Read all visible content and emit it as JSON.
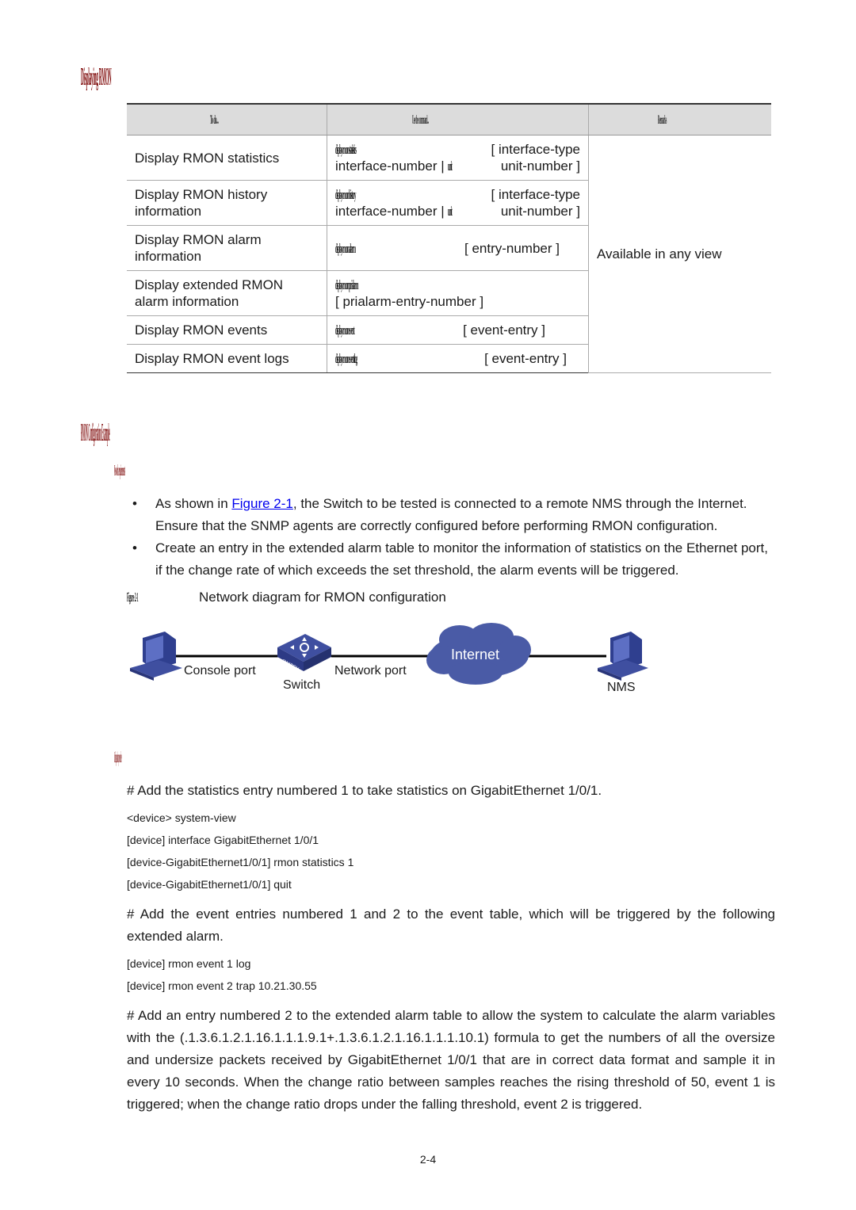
{
  "headings": {
    "displaying": "Displaying RMON",
    "config_example": "RMON Configuration Example",
    "network_requirements": "Network requirements",
    "configuration_procedure": "Configuration procedure"
  },
  "table": {
    "headers": [
      "To do...",
      "Use the command...",
      "Remarks"
    ],
    "rows": [
      {
        "todo": "Display RMON statistics",
        "kw": "display rmon statistics",
        "args_line1": "[ interface-type",
        "args_line2_pre": "interface-number | ",
        "kw2": "unit",
        "args_line2_post": "unit-number ]"
      },
      {
        "todo": "Display RMON history information",
        "kw": "display rmon history",
        "args_line1": "[ interface-type",
        "args_line2_pre": "interface-number | ",
        "kw2": "unit",
        "args_line2_post": "unit-number ]"
      },
      {
        "todo": "Display RMON alarm information",
        "kw": "display rmon alarm",
        "args_line1": "[ entry-number ]"
      },
      {
        "todo": "Display extended RMON alarm information",
        "kw": "display rmon prialarm",
        "args_line2": "[ prialarm-entry-number ]"
      },
      {
        "todo": "Display RMON events",
        "kw": "display rmon event",
        "args_line1": "[ event-entry ]"
      },
      {
        "todo": "Display RMON event logs",
        "kw": "display rmon eventlog",
        "args_line1": "[ event-entry ]"
      }
    ],
    "remarks": "Available in any view"
  },
  "requirements": {
    "bullets": [
      {
        "pre": "As shown in ",
        "link": "Figure 2-1",
        "post": ", the Switch to be tested is connected to a remote NMS through the Internet. Ensure that the SNMP agents are correctly configured before performing RMON configuration."
      },
      {
        "text": "Create an entry in the extended alarm table to monitor the information of statistics on the Ethernet port, if the change rate of which exceeds the set threshold, the alarm events will be triggered."
      }
    ]
  },
  "figure": {
    "number": "Figure 2-1",
    "caption": "Network diagram for RMON configuration",
    "labels": {
      "console_port": "Console port",
      "switch": "Switch",
      "switch_badge": "SWITCH",
      "network_port": "Network port",
      "internet": "Internet",
      "nms": "NMS"
    },
    "colors": {
      "device": "#3f4fa0",
      "cloud": "#4a5ba6"
    }
  },
  "procedure": {
    "step1": "# Add the statistics entry numbered 1 to take statistics on GigabitEthernet 1/0/1.",
    "code1": [
      "<device> system-view",
      "[device] interface GigabitEthernet 1/0/1",
      "[device-GigabitEthernet1/0/1] rmon statistics 1",
      "[device-GigabitEthernet1/0/1] quit"
    ],
    "step2": "# Add the event entries numbered 1 and 2 to the event table, which will be triggered by the following extended alarm.",
    "code2": [
      "[device] rmon event 1 log",
      "[device] rmon event 2 trap 10.21.30.55"
    ],
    "step3": "# Add an entry numbered 2 to the extended alarm table to allow the system to calculate the alarm variables with the (.1.3.6.1.2.1.16.1.1.1.9.1+.1.3.6.1.2.1.16.1.1.1.10.1) formula to get the numbers of all the oversize and undersize packets received by GigabitEthernet 1/0/1 that are in correct data format and sample it in every 10 seconds. When the change ratio between samples reaches the rising threshold of 50, event 1 is triggered; when the change ratio drops under the falling threshold, event 2 is triggered."
  },
  "page_number": "2-4"
}
